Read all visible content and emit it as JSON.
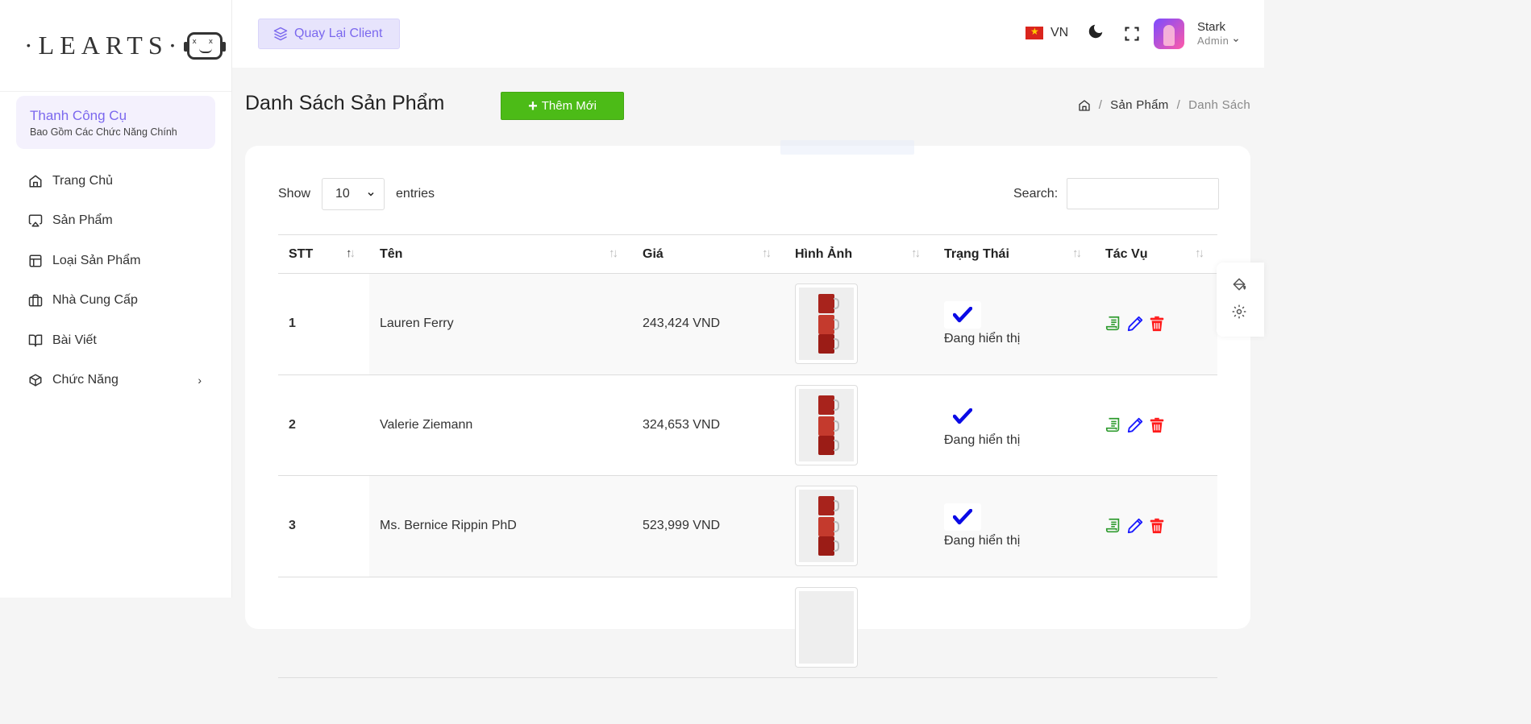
{
  "logo": {
    "text": "·LEARTS·",
    "robot_eyes": "x x"
  },
  "sidebar": {
    "tools_title": "Thanh Công Cụ",
    "tools_sub": "Bao Gồm Các Chức Năng Chính",
    "items": [
      {
        "label": "Trang Chủ",
        "icon": "home-icon"
      },
      {
        "label": "Sản Phẩm",
        "icon": "airplay-icon"
      },
      {
        "label": "Loại Sản Phẩm",
        "icon": "layout-icon"
      },
      {
        "label": "Nhà Cung Cấp",
        "icon": "briefcase-icon"
      },
      {
        "label": "Bài Viết",
        "icon": "book-open-icon"
      },
      {
        "label": "Chức Năng",
        "icon": "box-icon",
        "chevron": "›"
      }
    ]
  },
  "header": {
    "back_label": "Quay Lại Client",
    "lang": "VN",
    "user_name": "Stark",
    "user_role": "Admin"
  },
  "page": {
    "title": "Danh Sách Sản Phẩm",
    "add_label": "Thêm Mới",
    "add_plus": "+",
    "breadcrumb": {
      "sep": "/",
      "item1": "Sản Phẩm",
      "item2": "Danh Sách"
    }
  },
  "table_controls": {
    "show": "Show",
    "entries_value": "10",
    "entries": "entries",
    "search": "Search:"
  },
  "table": {
    "columns": [
      "STT",
      "Tên",
      "Giá",
      "Hình Ảnh",
      "Trạng Thái",
      "Tác Vụ"
    ],
    "rows": [
      {
        "stt": "1",
        "name": "Lauren Ferry",
        "price": "243,424 VND",
        "status": "Đang hiển thị"
      },
      {
        "stt": "2",
        "name": "Valerie Ziemann",
        "price": "324,653 VND",
        "status": "Đang hiển thị"
      },
      {
        "stt": "3",
        "name": "Ms. Bernice Rippin PhD",
        "price": "523,999 VND",
        "status": "Đang hiển thị"
      }
    ]
  },
  "colors": {
    "accent": "#7b68ee",
    "add_green": "#4cbb17",
    "action_green": "#2e9b2e",
    "action_blue": "#1a1aff",
    "action_red": "#ff1a1a",
    "check_blue": "#0a0ae6"
  }
}
